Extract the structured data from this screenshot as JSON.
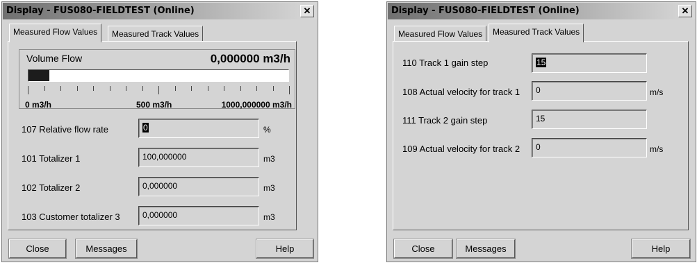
{
  "dialog1": {
    "title": "Display - FUS080-FIELDTEST  (Online)",
    "tabs": [
      {
        "label": "Measured Flow Values",
        "active": true
      },
      {
        "label": "Measured Track Values",
        "active": false
      }
    ],
    "volume_flow": {
      "label": "Volume Flow",
      "value": "0,000000 m3/h",
      "bar_fill_fraction": 0.08,
      "scale_labels": [
        "0 m3/h",
        "500 m3/h",
        "1000,000000 m3/h"
      ]
    },
    "rows": [
      {
        "label": "107  Relative flow rate",
        "value": "0",
        "unit": "%"
      },
      {
        "label": "101  Totalizer 1",
        "value": "100,000000",
        "unit": "m3"
      },
      {
        "label": "102  Totalizer 2",
        "value": "0,000000",
        "unit": "m3"
      },
      {
        "label": "103  Customer totalizer 3",
        "value": "0,000000",
        "unit": "m3"
      }
    ],
    "buttons": {
      "close": "Close",
      "messages": "Messages",
      "help": "Help"
    }
  },
  "dialog2": {
    "title": "Display - FUS080-FIELDTEST  (Online)",
    "tabs": [
      {
        "label": "Measured Flow Values",
        "active": false
      },
      {
        "label": "Measured Track Values",
        "active": true
      }
    ],
    "rows": [
      {
        "label": "110  Track 1 gain step",
        "value": "15",
        "unit": ""
      },
      {
        "label": "108  Actual velocity for track 1",
        "value": "0",
        "unit": "m/s"
      },
      {
        "label": "111  Track 2 gain step",
        "value": "15",
        "unit": ""
      },
      {
        "label": "109  Actual velocity for track 2",
        "value": "0",
        "unit": "m/s"
      }
    ],
    "buttons": {
      "close": "Close",
      "messages": "Messages",
      "help": "Help"
    }
  },
  "icons": {
    "close": "close-icon"
  }
}
